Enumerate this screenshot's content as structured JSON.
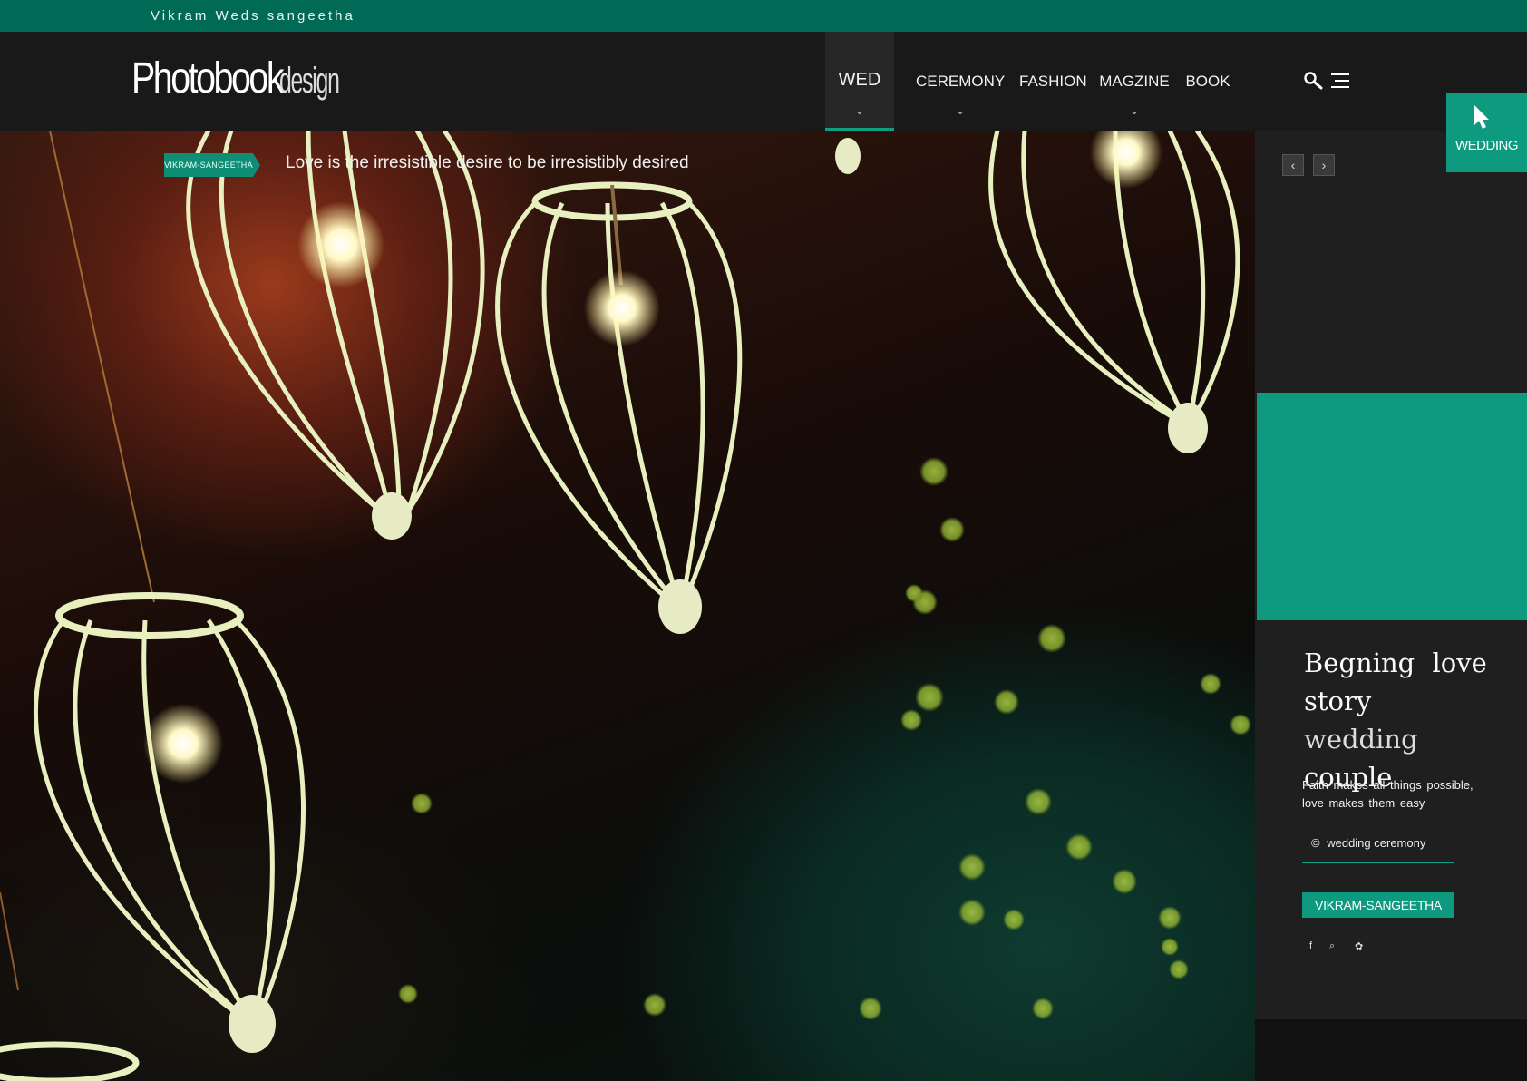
{
  "topbar": {
    "text": "Vikram Weds  sangeetha"
  },
  "logo": {
    "main": "Photobook",
    "sub": "design"
  },
  "nav": {
    "items": [
      {
        "label": "WED",
        "active": true,
        "has_dropdown": true
      },
      {
        "label": "CEREMONY",
        "has_dropdown": true
      },
      {
        "label": "FASHION",
        "has_dropdown": false
      },
      {
        "label": "MAGZINE",
        "has_dropdown": true
      },
      {
        "label": "BOOK",
        "has_dropdown": false
      }
    ],
    "chevron": "⌄"
  },
  "header_icons": {
    "search": "search-icon",
    "menu": "menu-icon"
  },
  "hero": {
    "tag": "VIKRAM-SANGEETHA",
    "quote": "Love is the irresistible desire to be irresistibly desired"
  },
  "slider": {
    "prev": "‹",
    "next": "›"
  },
  "wedding_badge": {
    "label": "WEDDING",
    "icon": "cursor-icon"
  },
  "sidebar": {
    "title_words": [
      "Begning",
      "love",
      "story",
      "wedding",
      "couple"
    ],
    "subtitle": "Faith makes all things possible, love makes them easy",
    "ceremony_symbol": "©",
    "ceremony_label": "wedding ceremony",
    "button_label": "VIKRAM-SANGEETHA",
    "social": [
      "f",
      "⌕",
      "✿"
    ]
  },
  "colors": {
    "accent": "#0e9a7e",
    "topbar": "#006a56",
    "header": "#191919"
  }
}
